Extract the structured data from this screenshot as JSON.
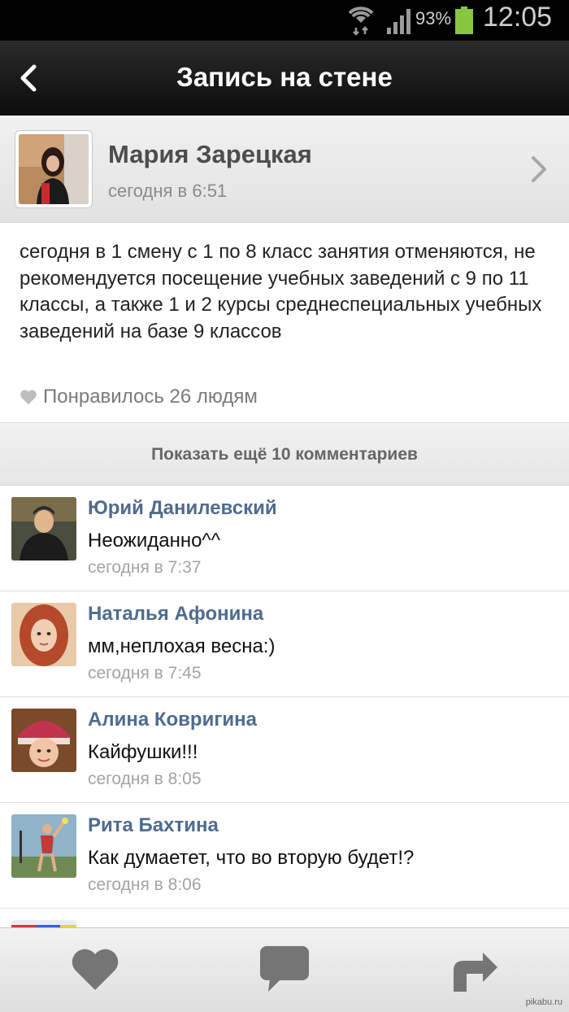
{
  "status_bar": {
    "battery_percent": "93%",
    "battery_level": 0.93,
    "time": "12:05",
    "icons": [
      "wifi-icon",
      "signal-icon",
      "battery-icon"
    ]
  },
  "header": {
    "title": "Запись на стене",
    "back_icon": "chevron-left-icon"
  },
  "author": {
    "name": "Мария Зарецкая",
    "time": "сегодня в 6:51",
    "chevron_icon": "chevron-right-icon"
  },
  "post": {
    "text": "сегодня в 1 смену с 1 по 8 класс занятия отменяются, не рекомендуется посещение учебных заведений с 9 по 11 классы, а также 1 и 2 курсы среднеспециальных учебных заведений на базе 9 классов",
    "likes_text": "Понравилось 26 людям",
    "likes_icon": "heart-icon"
  },
  "show_more": {
    "label": "Показать ещё 10 комментариев"
  },
  "comments": [
    {
      "name": "Юрий Данилевский",
      "text": "Неожиданно^^",
      "time": "сегодня в 7:37"
    },
    {
      "name": "Наталья Афонина",
      "text": "мм,неплохая весна:)",
      "time": "сегодня в 7:45"
    },
    {
      "name": "Алина Ковригина",
      "text": "Кайфушки!!!",
      "time": "сегодня в 8:05"
    },
    {
      "name": "Рита Бахтина",
      "text": "Как думаетет, что во вторую будет!?",
      "time": "сегодня в 8:06"
    }
  ],
  "toolbar": {
    "buttons": [
      "heart-icon",
      "comment-icon",
      "share-icon"
    ]
  },
  "watermark": "pikabu.ru",
  "colors": {
    "header_bg": "#111111",
    "name_link": "#4f6b8f",
    "battery": "#8ac53f"
  }
}
